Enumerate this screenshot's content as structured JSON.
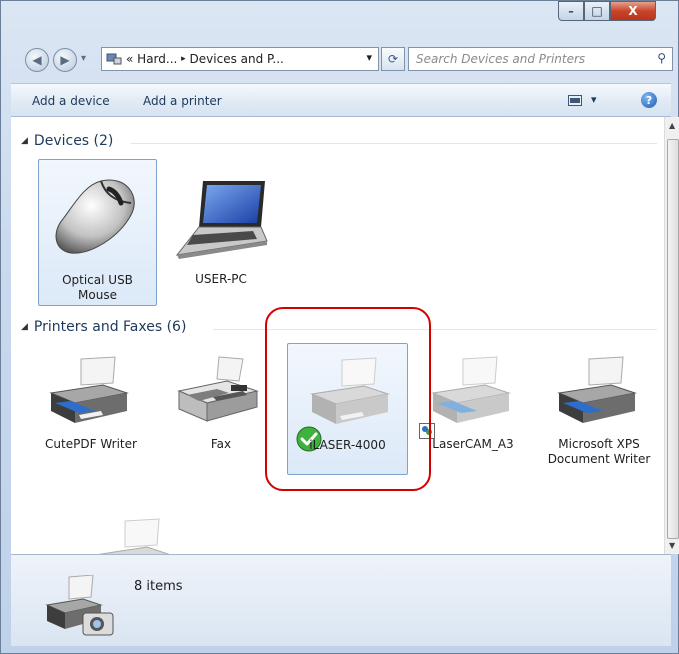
{
  "window": {
    "controls": {
      "minimize": "–",
      "maximize": "□",
      "close": "X"
    }
  },
  "nav": {
    "back_icon": "◀",
    "forward_icon": "▶",
    "dropdown": "▾"
  },
  "address": {
    "segments": [
      "«",
      "Hard...",
      "▸",
      "Devices and P..."
    ],
    "dropdown": "▾",
    "refresh_icon": "⟳"
  },
  "search": {
    "placeholder": "Search Devices and Printers",
    "icon": "⚲"
  },
  "toolbar": {
    "add_device": "Add a device",
    "add_printer": "Add a printer",
    "view_dropdown": "▾",
    "help_icon": "?"
  },
  "groups": {
    "devices": {
      "label": "Devices (2)",
      "items": [
        {
          "label1": "Optical USB",
          "label2": "Mouse"
        },
        {
          "label1": "USER-PC"
        }
      ]
    },
    "printers": {
      "label": "Printers and Faxes (6)",
      "items": [
        {
          "label1": "CutePDF Writer"
        },
        {
          "label1": "Fax"
        },
        {
          "label1": "iLASER-4000"
        },
        {
          "label1": "LaserCAM_A3"
        },
        {
          "label1": "Microsoft XPS",
          "label2": "Document Writer"
        }
      ]
    }
  },
  "status": {
    "items_count": "8 items"
  },
  "colors": {
    "highlight_circle": "#d40000",
    "selection": "#dce9f8"
  }
}
